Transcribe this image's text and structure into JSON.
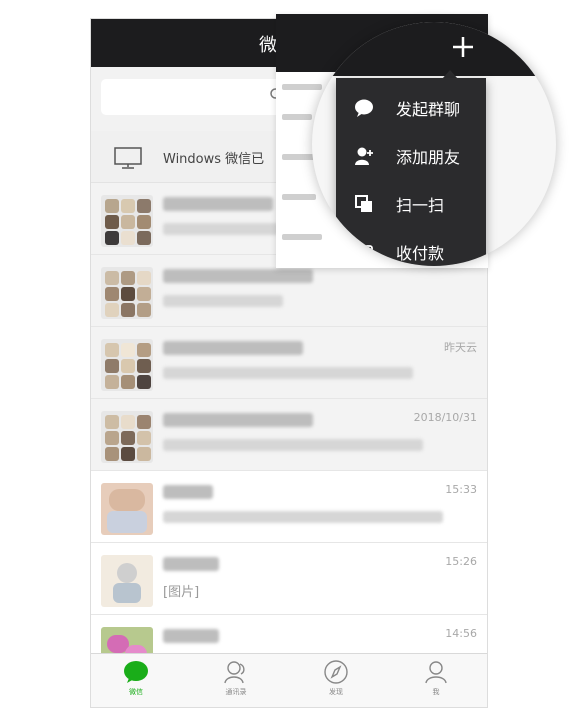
{
  "header": {
    "title_partial": "微"
  },
  "windows_login": {
    "label": "Windows 微信已"
  },
  "chats": [
    {
      "time": "",
      "preview": ""
    },
    {
      "time": "",
      "preview": ""
    },
    {
      "time": "昨天云",
      "preview": ""
    },
    {
      "time": "2018/10/31",
      "preview": ""
    },
    {
      "time": "15:33",
      "preview": ""
    },
    {
      "time": "15:26",
      "preview": "[图片]"
    },
    {
      "time": "14:56",
      "preview": ""
    }
  ],
  "tabs": [
    {
      "label": "微信"
    },
    {
      "label": "通讯录"
    },
    {
      "label": "发现"
    },
    {
      "label": "我"
    }
  ],
  "popup_menu": {
    "items": [
      {
        "label": "发起群聊",
        "icon": "chat-bubble-icon"
      },
      {
        "label": "添加朋友",
        "icon": "add-friend-icon"
      },
      {
        "label": "扫一扫",
        "icon": "scan-icon"
      },
      {
        "label": "收付款",
        "icon": "payment-icon"
      }
    ]
  },
  "colors": {
    "accent": "#1aad19",
    "topbar": "#1c1c1e",
    "menu_bg": "#2b2b2d"
  }
}
